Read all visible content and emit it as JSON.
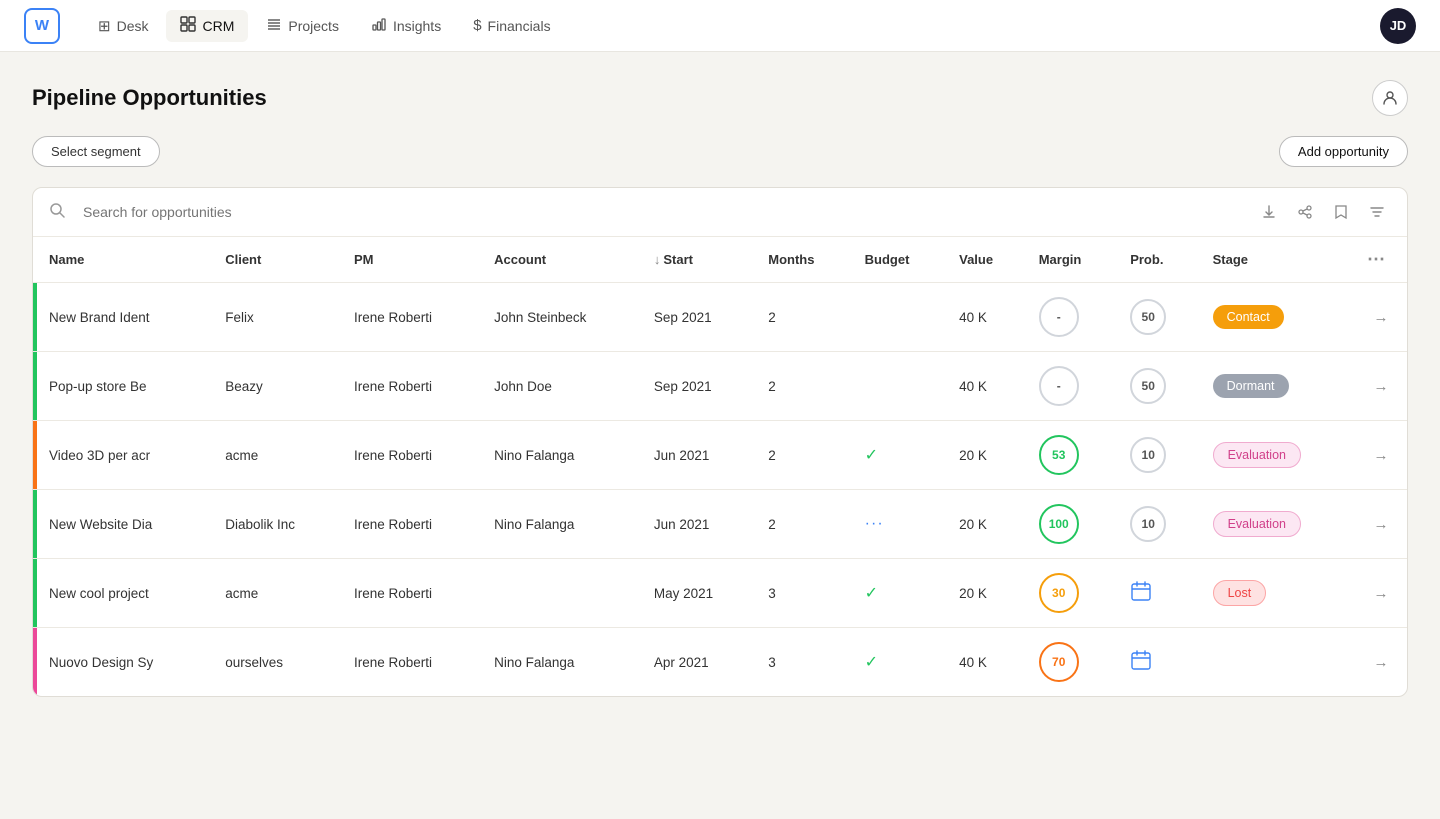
{
  "app": {
    "logo": "W",
    "avatar": "JD"
  },
  "nav": {
    "items": [
      {
        "id": "desk",
        "label": "Desk",
        "icon": "⊞"
      },
      {
        "id": "crm",
        "label": "CRM",
        "icon": "📊",
        "active": true
      },
      {
        "id": "projects",
        "label": "Projects",
        "icon": "≡"
      },
      {
        "id": "insights",
        "label": "Insights",
        "icon": "📈"
      },
      {
        "id": "financials",
        "label": "Financials",
        "icon": "$"
      }
    ]
  },
  "page": {
    "title": "Pipeline Opportunities",
    "select_segment_label": "Select segment",
    "add_opportunity_label": "Add opportunity"
  },
  "search": {
    "placeholder": "Search for opportunities"
  },
  "table": {
    "columns": [
      {
        "id": "name",
        "label": "Name",
        "sort": false
      },
      {
        "id": "client",
        "label": "Client",
        "sort": false
      },
      {
        "id": "pm",
        "label": "PM",
        "sort": false
      },
      {
        "id": "account",
        "label": "Account",
        "sort": false
      },
      {
        "id": "start",
        "label": "Start",
        "sort": true
      },
      {
        "id": "months",
        "label": "Months",
        "sort": false
      },
      {
        "id": "budget",
        "label": "Budget",
        "sort": false
      },
      {
        "id": "value",
        "label": "Value",
        "sort": false
      },
      {
        "id": "margin",
        "label": "Margin",
        "sort": false
      },
      {
        "id": "prob",
        "label": "Prob.",
        "sort": false
      },
      {
        "id": "stage",
        "label": "Stage",
        "sort": false
      }
    ],
    "rows": [
      {
        "indicator": "green",
        "name": "New Brand Ident",
        "client": "Felix",
        "pm": "Irene Roberti",
        "account": "John Steinbeck",
        "start": "Sep 2021",
        "months": "2",
        "budget_type": "empty",
        "value": "40  K",
        "margin": "-",
        "margin_class": "margin-dash",
        "prob": "50",
        "stage": "Contact",
        "stage_class": "badge-contact"
      },
      {
        "indicator": "green",
        "name": "Pop-up store Be",
        "client": "Beazy",
        "pm": "Irene Roberti",
        "account": "John Doe",
        "start": "Sep 2021",
        "months": "2",
        "budget_type": "empty",
        "value": "40  K",
        "margin": "-",
        "margin_class": "margin-dash",
        "prob": "50",
        "stage": "Dormant",
        "stage_class": "badge-dormant"
      },
      {
        "indicator": "orange",
        "name": "Video 3D per acr",
        "client": "acme",
        "pm": "Irene Roberti",
        "account": "Nino Falanga",
        "start": "Jun 2021",
        "months": "2",
        "budget_type": "check",
        "value": "20  K",
        "margin": "53",
        "margin_class": "margin-53",
        "prob": "10",
        "stage": "Evaluation",
        "stage_class": "badge-evaluation"
      },
      {
        "indicator": "green",
        "name": "New Website Dia",
        "client": "Diabolik Inc",
        "pm": "Irene Roberti",
        "account": "Nino Falanga",
        "start": "Jun 2021",
        "months": "2",
        "budget_type": "dots",
        "value": "20  K",
        "margin": "100",
        "margin_class": "margin-100",
        "prob": "10",
        "stage": "Evaluation",
        "stage_class": "badge-evaluation"
      },
      {
        "indicator": "green",
        "name": "New cool project",
        "client": "acme",
        "pm": "Irene Roberti",
        "account": "",
        "start": "May 2021",
        "months": "3",
        "budget_type": "check",
        "value": "20  K",
        "margin": "30",
        "margin_class": "margin-30",
        "prob_type": "calendar",
        "stage": "Lost",
        "stage_class": "badge-lost"
      },
      {
        "indicator": "pink",
        "name": "Nuovo Design Sy",
        "client": "ourselves",
        "pm": "Irene Roberti",
        "account": "Nino Falanga",
        "start": "Apr 2021",
        "months": "3",
        "budget_type": "check",
        "value": "40  K",
        "margin": "70",
        "margin_class": "margin-70",
        "prob_type": "calendar",
        "stage": "",
        "stage_class": ""
      }
    ]
  }
}
